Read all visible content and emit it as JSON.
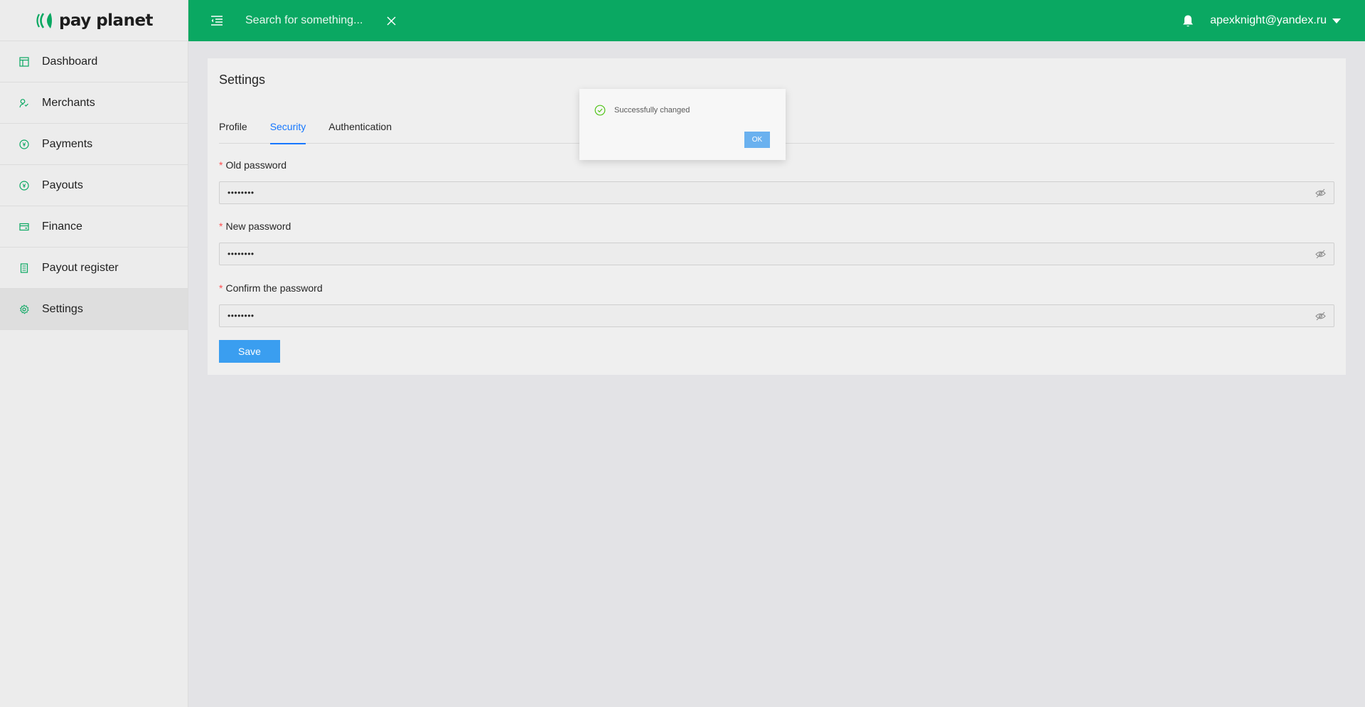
{
  "brand": {
    "name": "pay planet",
    "accent_color": "#0aa862"
  },
  "sidebar": {
    "items": [
      {
        "label": "Dashboard",
        "icon": "dashboard-icon"
      },
      {
        "label": "Merchants",
        "icon": "merchants-icon"
      },
      {
        "label": "Payments",
        "icon": "payments-icon"
      },
      {
        "label": "Payouts",
        "icon": "payouts-icon"
      },
      {
        "label": "Finance",
        "icon": "finance-icon"
      },
      {
        "label": "Payout register",
        "icon": "register-icon"
      },
      {
        "label": "Settings",
        "icon": "settings-icon",
        "active": true
      }
    ]
  },
  "header": {
    "search_placeholder": "Search for something...",
    "user_email": "apexknight@yandex.ru"
  },
  "page": {
    "title": "Settings",
    "tabs": [
      {
        "label": "Profile"
      },
      {
        "label": "Security",
        "active": true
      },
      {
        "label": "Authentication"
      }
    ],
    "form": {
      "old_password": {
        "label": "Old password",
        "value": "••••••••"
      },
      "new_password": {
        "label": "New password",
        "value": "••••••••"
      },
      "confirm_password": {
        "label": "Confirm the password",
        "value": "••••••••"
      },
      "save_label": "Save"
    }
  },
  "modal": {
    "message": "Successfully changed",
    "ok_label": "OK"
  }
}
